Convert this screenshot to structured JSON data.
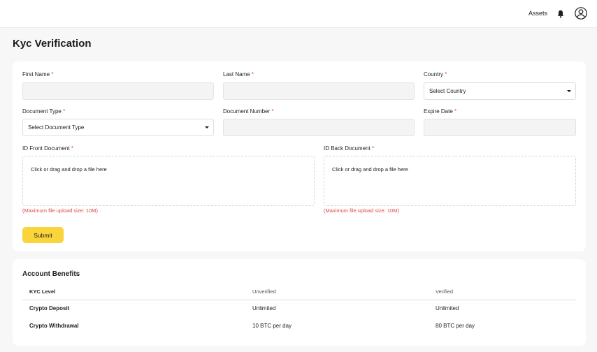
{
  "header": {
    "assets_label": "Assets",
    "icons": [
      "bell-icon",
      "user-avatar-icon"
    ]
  },
  "page": {
    "title": "Kyc Verification"
  },
  "form": {
    "required_mark": "*",
    "first_name": {
      "label": "First Name",
      "value": ""
    },
    "last_name": {
      "label": "Last Name",
      "value": ""
    },
    "country": {
      "label": "Country",
      "selected": "Select Country"
    },
    "document_type": {
      "label": "Document Type",
      "selected": "Select Document Type"
    },
    "document_number": {
      "label": "Document Number",
      "value": ""
    },
    "expire_date": {
      "label": "Expire Date",
      "value": ""
    },
    "id_front": {
      "label": "ID Front Document",
      "dropzone_text": "Click or drag and drop a file here",
      "hint": "(Maximum file upload size: 10M)"
    },
    "id_back": {
      "label": "ID Back Document",
      "dropzone_text": "Click or drag and drop a file here",
      "hint": "(Maximum file upload size: 10M)"
    },
    "submit_label": "Submit"
  },
  "benefits": {
    "title": "Account Benefits",
    "columns": [
      "KYC Level",
      "Unverified",
      "Verified"
    ],
    "rows": [
      [
        "Crypto Deposit",
        "Unlimited",
        "Unlimited"
      ],
      [
        "Crypto Withdrawal",
        "10 BTC per day",
        "80 BTC per day"
      ]
    ]
  },
  "colors": {
    "accent": "#f9d43a",
    "required": "#e04545",
    "background": "#f7f7f7",
    "card": "#ffffff"
  }
}
